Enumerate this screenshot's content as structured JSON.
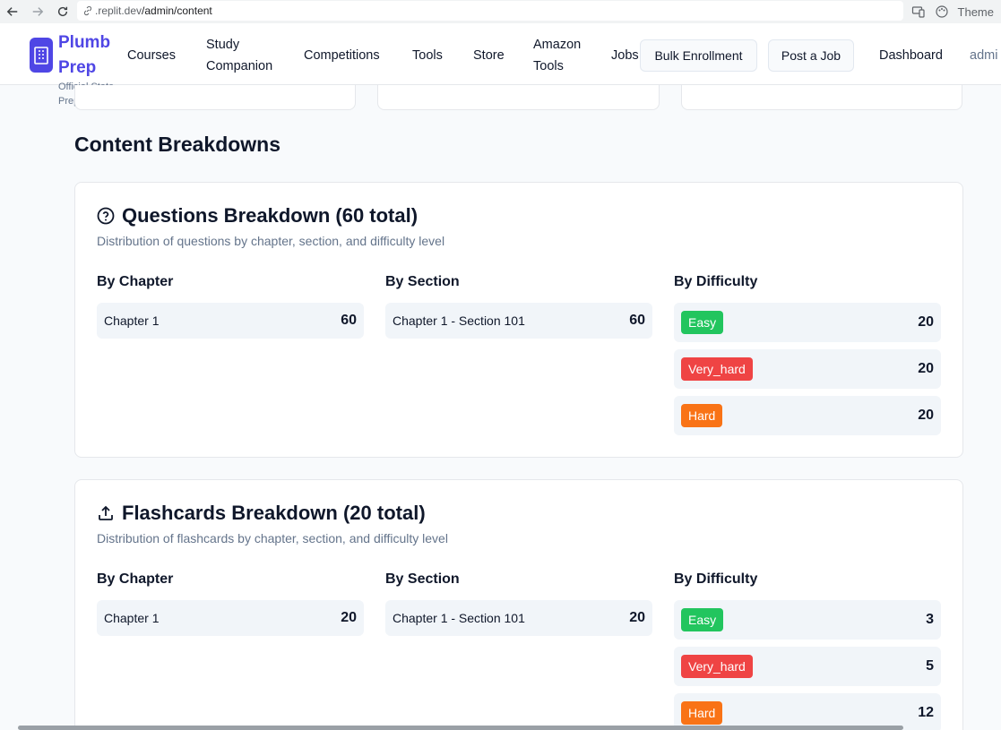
{
  "browser": {
    "url_host": ".replit.dev",
    "url_path": "/admin/content",
    "theme_label": "Theme"
  },
  "brand": {
    "name": "Plumb Prep",
    "tagline": "Official State Prep Course"
  },
  "nav": {
    "courses": "Courses",
    "study_companion": "Study Companion",
    "competitions": "Competitions",
    "tools": "Tools",
    "store": "Store",
    "amazon_tools": "Amazon Tools",
    "jobs": "Jobs",
    "bulk_enrollment": "Bulk Enrollment",
    "post_job": "Post a Job",
    "dashboard": "Dashboard",
    "admin": "admi"
  },
  "page": {
    "section_title": "Content Breakdowns"
  },
  "questions": {
    "title": "Questions Breakdown (60 total)",
    "description": "Distribution of questions by chapter, section, and difficulty level",
    "by_chapter_label": "By Chapter",
    "by_section_label": "By Section",
    "by_difficulty_label": "By Difficulty",
    "chapters": [
      {
        "name": "Chapter 1",
        "count": "60"
      }
    ],
    "sections": [
      {
        "name": "Chapter 1 - Section 101",
        "count": "60"
      }
    ],
    "difficulty": [
      {
        "name": "Easy",
        "count": "20",
        "color": "#22c55e"
      },
      {
        "name": "Very_hard",
        "count": "20",
        "color": "#ef4444"
      },
      {
        "name": "Hard",
        "count": "20",
        "color": "#f97316"
      }
    ]
  },
  "flashcards": {
    "title": "Flashcards Breakdown (20 total)",
    "description": "Distribution of flashcards by chapter, section, and difficulty level",
    "by_chapter_label": "By Chapter",
    "by_section_label": "By Section",
    "by_difficulty_label": "By Difficulty",
    "chapters": [
      {
        "name": "Chapter 1",
        "count": "20"
      }
    ],
    "sections": [
      {
        "name": "Chapter 1 - Section 101",
        "count": "20"
      }
    ],
    "difficulty": [
      {
        "name": "Easy",
        "count": "3",
        "color": "#22c55e"
      },
      {
        "name": "Very_hard",
        "count": "5",
        "color": "#ef4444"
      },
      {
        "name": "Hard",
        "count": "12",
        "color": "#f97316"
      }
    ]
  }
}
